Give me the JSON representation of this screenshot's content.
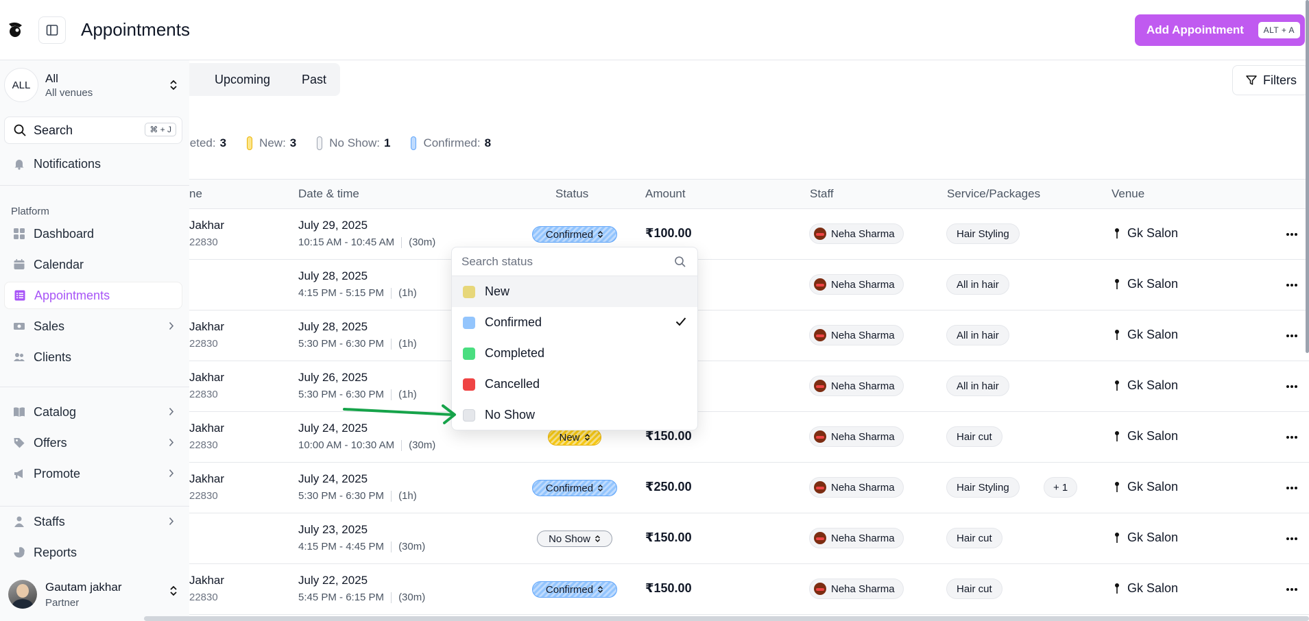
{
  "header": {
    "title": "Appointments",
    "add_button": "Add Appointment",
    "add_shortcut": "ALT + A"
  },
  "tabs": [
    "Upcoming",
    "Past"
  ],
  "filters_label": "Filters",
  "summary": [
    {
      "label": "leted:",
      "count": "3",
      "color": "#22c55e"
    },
    {
      "label": "New:",
      "count": "3",
      "color": "#facc15"
    },
    {
      "label": "No Show:",
      "count": "1",
      "color": "#e5e7eb"
    },
    {
      "label": "Confirmed:",
      "count": "8",
      "color": "#93c5fd"
    }
  ],
  "table": {
    "headers": [
      "ne",
      "Date & time",
      "Status",
      "Amount",
      "Staff",
      "Service/Packages",
      "Venue"
    ],
    "rows": [
      {
        "name": "Jakhar",
        "phone": "22830",
        "date": "July 29, 2025",
        "time": "10:15 AM - 10:45 AM",
        "duration": "(30m)",
        "status": "Confirmed",
        "amount": "₹100.00",
        "staff": "Neha Sharma",
        "service": "Hair Styling",
        "extra": "",
        "venue": "Gk Salon"
      },
      {
        "name": "",
        "phone": "",
        "date": "July 28, 2025",
        "time": "4:15 PM - 5:15 PM",
        "duration": "(1h)",
        "status": "",
        "amount": "",
        "staff": "Neha Sharma",
        "service": "All in hair",
        "extra": "",
        "venue": "Gk Salon"
      },
      {
        "name": "Jakhar",
        "phone": "22830",
        "date": "July 28, 2025",
        "time": "5:30 PM - 6:30 PM",
        "duration": "(1h)",
        "status": "",
        "amount": "",
        "staff": "Neha Sharma",
        "service": "All in hair",
        "extra": "",
        "venue": "Gk Salon"
      },
      {
        "name": "Jakhar",
        "phone": "22830",
        "date": "July 26, 2025",
        "time": "5:30 PM - 6:30 PM",
        "duration": "(1h)",
        "status": "",
        "amount": "",
        "staff": "Neha Sharma",
        "service": "All in hair",
        "extra": "",
        "venue": "Gk Salon"
      },
      {
        "name": "Jakhar",
        "phone": "22830",
        "date": "July 24, 2025",
        "time": "10:00 AM - 10:30 AM",
        "duration": "(30m)",
        "status": "New",
        "amount": "₹150.00",
        "staff": "Neha Sharma",
        "service": "Hair cut",
        "extra": "",
        "venue": "Gk Salon"
      },
      {
        "name": "Jakhar",
        "phone": "22830",
        "date": "July 24, 2025",
        "time": "5:30 PM - 6:30 PM",
        "duration": "(1h)",
        "status": "Confirmed",
        "amount": "₹250.00",
        "staff": "Neha Sharma",
        "service": "Hair Styling",
        "extra": "+ 1",
        "venue": "Gk Salon"
      },
      {
        "name": "",
        "phone": "",
        "date": "July 23, 2025",
        "time": "4:15 PM - 4:45 PM",
        "duration": "(30m)",
        "status": "No Show",
        "amount": "₹150.00",
        "staff": "Neha Sharma",
        "service": "Hair cut",
        "extra": "",
        "venue": "Gk Salon"
      },
      {
        "name": "Jakhar",
        "phone": "22830",
        "date": "July 22, 2025",
        "time": "5:45 PM - 6:15 PM",
        "duration": "(30m)",
        "status": "Confirmed",
        "amount": "₹150.00",
        "staff": "Neha Sharma",
        "service": "Hair cut",
        "extra": "",
        "venue": "Gk Salon"
      }
    ]
  },
  "sidebar": {
    "venue_avatar": "ALL",
    "venue_title": "All",
    "venue_sub": "All venues",
    "search_label": "Search",
    "search_shortcut": "⌘ + J",
    "notifications": "Notifications",
    "section_label": "Platform",
    "items": [
      {
        "label": "Dashboard",
        "icon": "dashboard-icon",
        "chevron": false,
        "active": false
      },
      {
        "label": "Calendar",
        "icon": "calendar-icon",
        "chevron": false,
        "active": false
      },
      {
        "label": "Appointments",
        "icon": "list-icon",
        "chevron": false,
        "active": true
      },
      {
        "label": "Sales",
        "icon": "cash-icon",
        "chevron": true,
        "active": false
      },
      {
        "label": "Clients",
        "icon": "users-icon",
        "chevron": false,
        "active": false
      },
      {
        "label": "Catalog",
        "icon": "book-icon",
        "chevron": true,
        "active": false
      },
      {
        "label": "Offers",
        "icon": "tag-icon",
        "chevron": true,
        "active": false
      },
      {
        "label": "Promote",
        "icon": "megaphone-icon",
        "chevron": true,
        "active": false
      },
      {
        "label": "Staffs",
        "icon": "staff-icon",
        "chevron": true,
        "active": false
      },
      {
        "label": "Reports",
        "icon": "pie-chart-icon",
        "chevron": false,
        "active": false
      }
    ],
    "user": {
      "name": "Gautam jakhar",
      "role": "Partner"
    }
  },
  "status_dropdown": {
    "placeholder": "Search status",
    "options": [
      {
        "label": "New",
        "color": "#e7d77a",
        "selected": false,
        "highlighted": true
      },
      {
        "label": "Confirmed",
        "color": "#93c5fd",
        "selected": true,
        "highlighted": false
      },
      {
        "label": "Completed",
        "color": "#4ade80",
        "selected": false,
        "highlighted": false
      },
      {
        "label": "Cancelled",
        "color": "#ef4444",
        "selected": false,
        "highlighted": false
      },
      {
        "label": "No Show",
        "color": "#e5e7eb",
        "selected": false,
        "highlighted": false
      }
    ]
  },
  "colors": {
    "accent": "#c05af0",
    "active_nav": "#a855f7",
    "annotation_arrow": "#16a34a"
  }
}
